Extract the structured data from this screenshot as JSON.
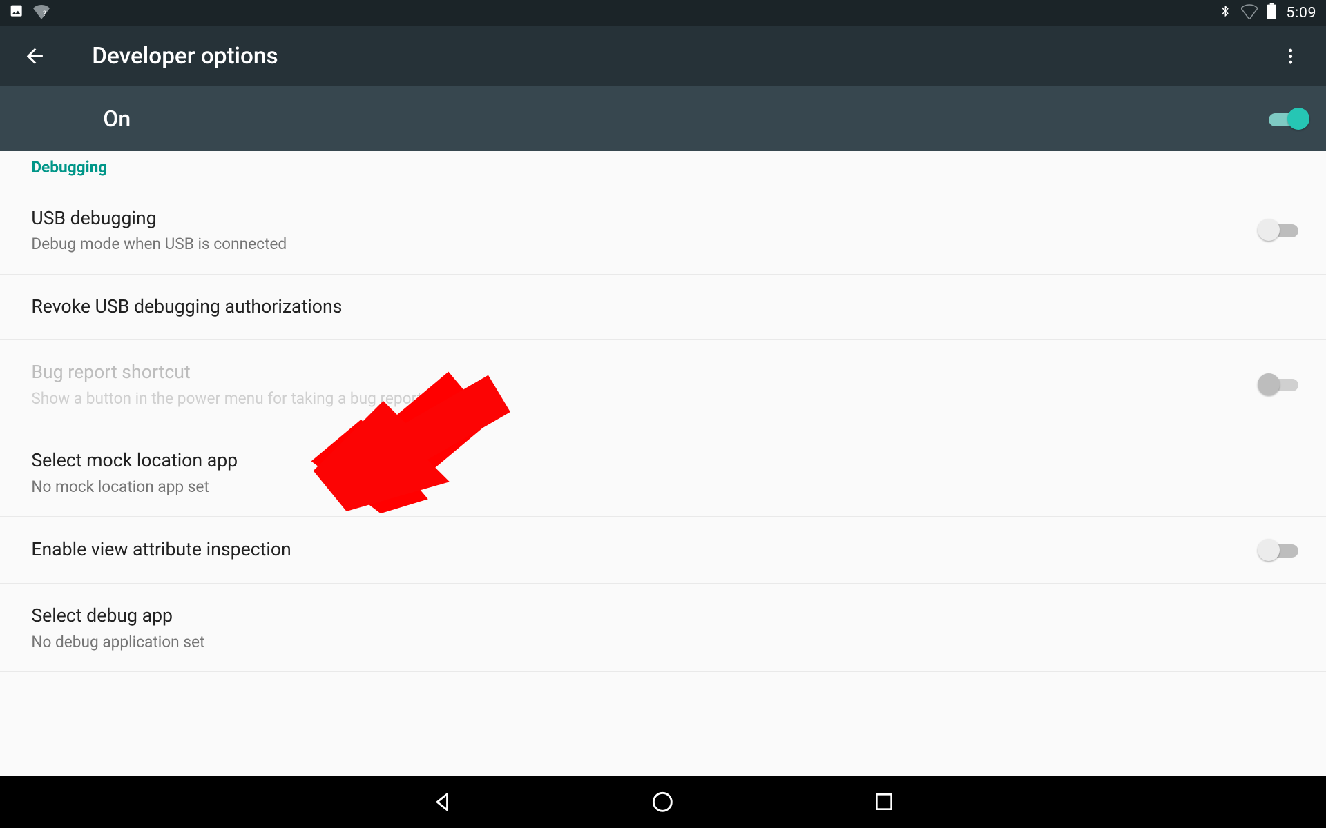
{
  "status": {
    "time": "5:09"
  },
  "header": {
    "title": "Developer options"
  },
  "master": {
    "label": "On",
    "on": true
  },
  "section": {
    "debugging": "Debugging"
  },
  "rows": {
    "usb_debug": {
      "title": "USB debugging",
      "sub": "Debug mode when USB is connected",
      "switch": false
    },
    "revoke": {
      "title": "Revoke USB debugging authorizations"
    },
    "bugreport": {
      "title": "Bug report shortcut",
      "sub": "Show a button in the power menu for taking a bug report",
      "switch": false,
      "disabled": true
    },
    "mockloc": {
      "title": "Select mock location app",
      "sub": "No mock location app set"
    },
    "viewattr": {
      "title": "Enable view attribute inspection",
      "switch": false
    },
    "debugapp": {
      "title": "Select debug app",
      "sub": "No debug application set"
    }
  }
}
